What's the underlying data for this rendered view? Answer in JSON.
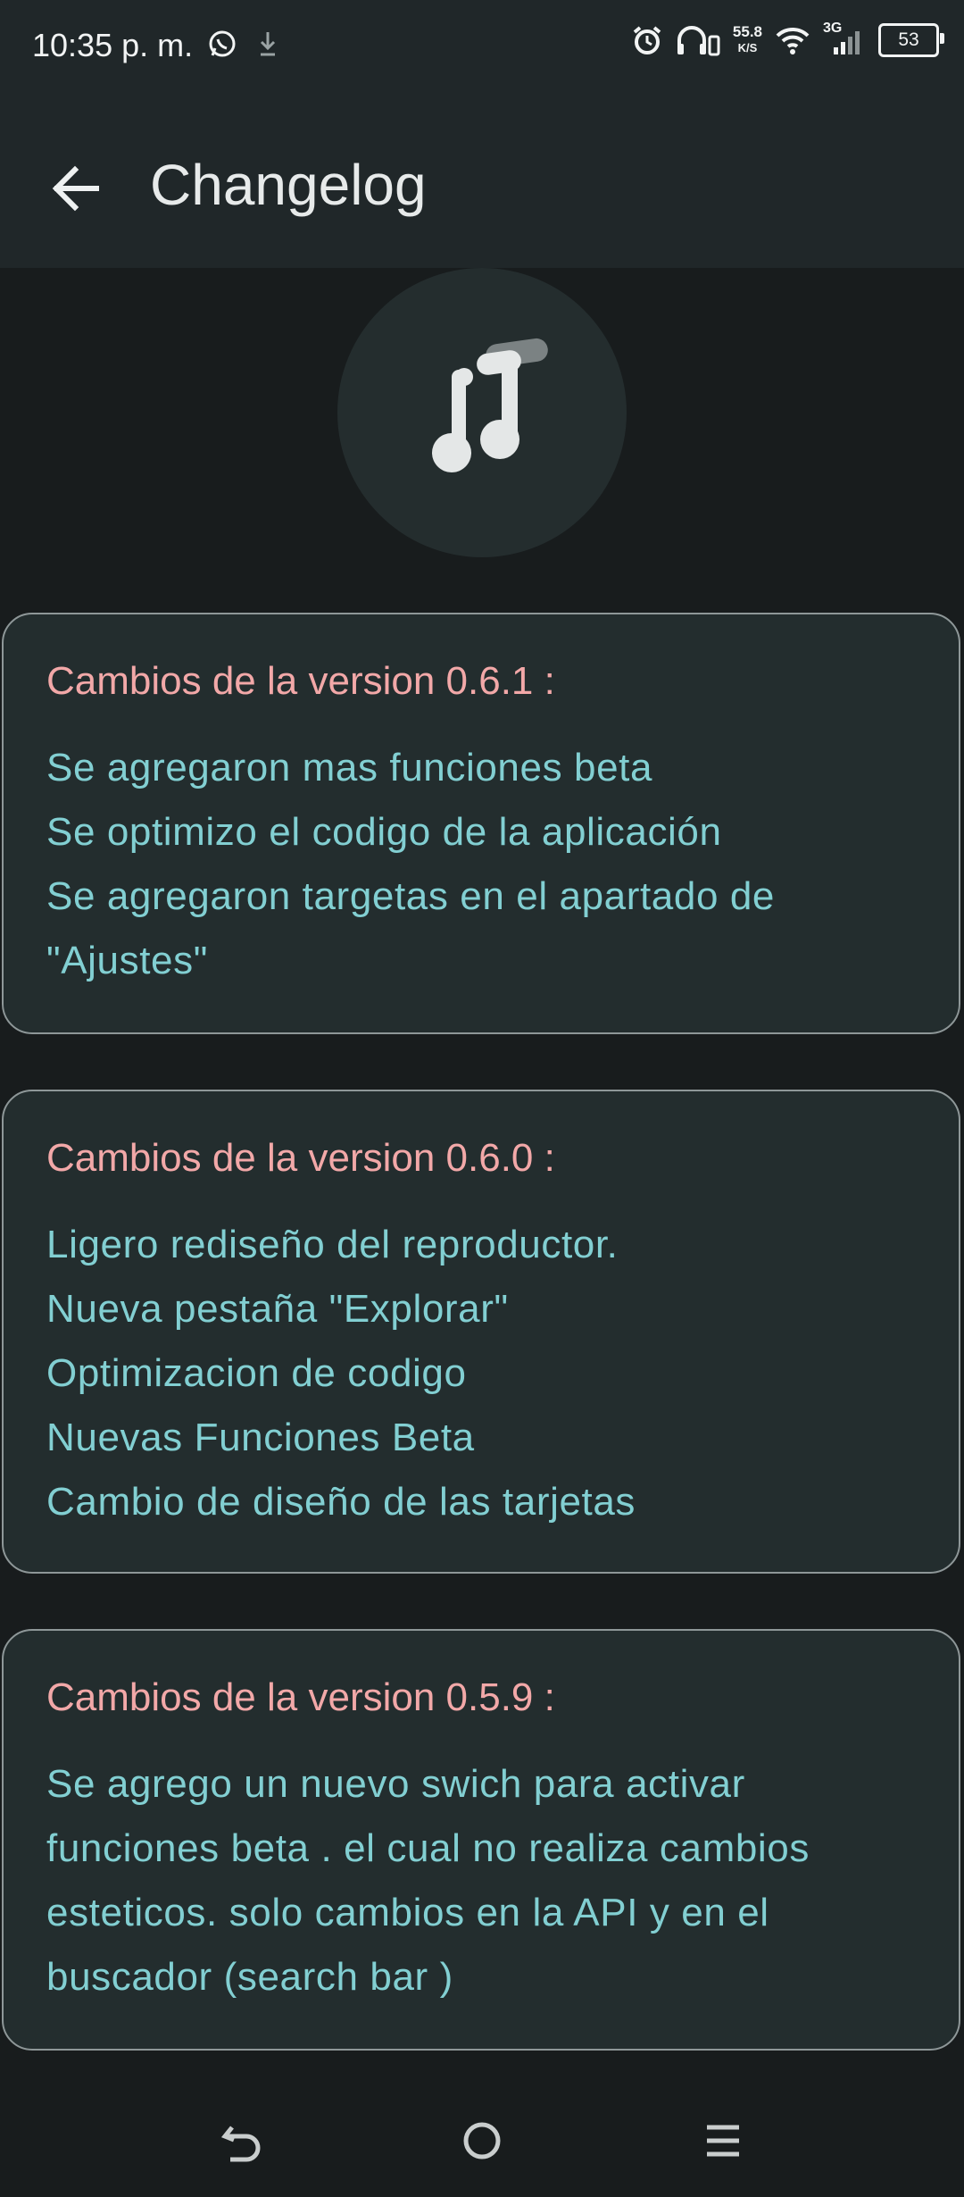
{
  "status_bar": {
    "time": "10:35 p. m.",
    "speed_value": "55.8",
    "speed_unit": "K/S",
    "network": "3G",
    "battery": "53"
  },
  "app_bar": {
    "title": "Changelog"
  },
  "colors": {
    "background": "#181c1d",
    "card": "#232d2e",
    "title_accent": "#f2a8a8",
    "body_text": "#82cfd2"
  },
  "cards": [
    {
      "title": "Cambios de la version 0.6.1 :",
      "lines": [
        "Se agregaron mas funciones beta",
        "Se optimizo el codigo de la aplicación",
        "Se agregaron targetas en el apartado de",
        "\"Ajustes\""
      ]
    },
    {
      "title": "Cambios de la version 0.6.0 :",
      "lines": [
        "Ligero rediseño del reproductor.",
        "Nueva pestaña \"Explorar\"",
        "Optimizacion de codigo",
        "Nuevas Funciones Beta",
        "Cambio de diseño de las tarjetas"
      ]
    },
    {
      "title": "Cambios de la version 0.5.9 :",
      "lines": [
        "Se agrego un nuevo swich para activar",
        "funciones beta . el cual no realiza cambios",
        "esteticos. solo cambios en la API y en el",
        "buscador (search bar )"
      ]
    }
  ],
  "icons": {
    "back": "arrow-left-icon",
    "logo": "music-note-icon",
    "nav_back": "back-icon",
    "nav_home": "home-icon",
    "nav_menu": "menu-icon"
  }
}
